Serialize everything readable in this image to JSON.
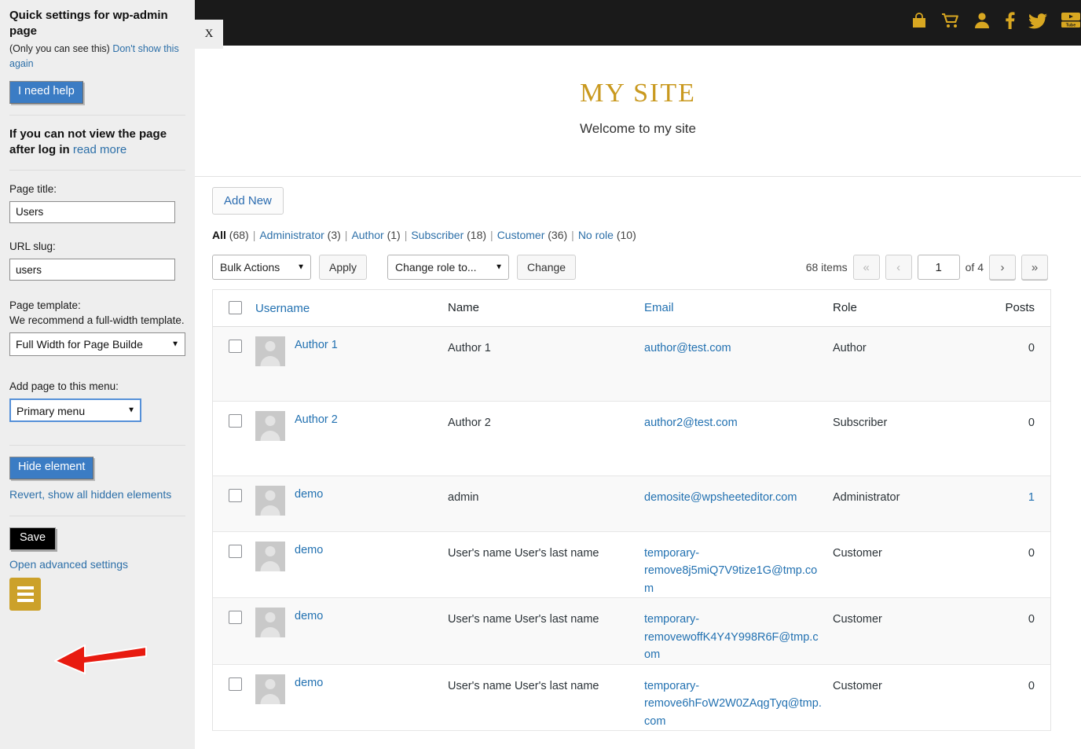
{
  "sidebar": {
    "heading": "Quick settings for wp-admin page",
    "note_text": "(Only you can see this)",
    "dont_show_link": "Don't show this again",
    "need_help_label": "I need help",
    "cant_view_text": "If you can not view the page after log in",
    "read_more_link": "read more",
    "page_title_label": "Page title:",
    "page_title_value": "Users",
    "url_slug_label": "URL slug:",
    "url_slug_value": "users",
    "page_template_label": "Page template:",
    "page_template_hint": "We recommend a full-width template.",
    "page_template_value": "Full Width for Page Builde",
    "menu_label": "Add page to this menu:",
    "menu_value": "Primary menu",
    "hide_element_label": "Hide element",
    "revert_link": "Revert, show all hidden elements",
    "save_label": "Save",
    "advanced_link": "Open advanced settings",
    "hamburger_icon": "hamburger-icon",
    "close_tab_label": "X"
  },
  "topbar": {
    "icons": [
      {
        "name": "shopping-bag-icon",
        "glyph": "bag"
      },
      {
        "name": "shopping-cart-icon",
        "glyph": "cart"
      },
      {
        "name": "user-account-icon",
        "glyph": "user"
      },
      {
        "name": "facebook-icon",
        "glyph": "f"
      },
      {
        "name": "twitter-icon",
        "glyph": "twitter"
      },
      {
        "name": "youtube-icon",
        "glyph": "youtube"
      }
    ],
    "icon_color": "#d8a721",
    "background": "#1a1a1a"
  },
  "site": {
    "title": "MY SITE",
    "tagline": "Welcome to my site",
    "title_color": "#c9991f"
  },
  "main": {
    "add_new_label": "Add New",
    "filters": [
      {
        "label": "All",
        "count": "(68)",
        "current": true
      },
      {
        "label": "Administrator",
        "count": "(3)",
        "current": false
      },
      {
        "label": "Author",
        "count": "(1)",
        "current": false
      },
      {
        "label": "Subscriber",
        "count": "(18)",
        "current": false
      },
      {
        "label": "Customer",
        "count": "(36)",
        "current": false
      },
      {
        "label": "No role",
        "count": "(10)",
        "current": false
      }
    ],
    "bulk_actions_value": "Bulk Actions",
    "apply_label": "Apply",
    "change_role_value": "Change role to...",
    "change_label": "Change",
    "items_count": "68 items",
    "page_first": "«",
    "page_prev": "‹",
    "page_current": "1",
    "page_of": "of 4",
    "page_next": "›",
    "page_last": "»",
    "columns": [
      "Username",
      "Name",
      "Email",
      "Role",
      "Posts"
    ],
    "rows": [
      {
        "username": "Author 1",
        "name": "Author 1",
        "email": "author@test.com",
        "role": "Author",
        "posts": "0"
      },
      {
        "username": "Author 2",
        "name": "Author 2",
        "email": "author2@test.com",
        "role": "Subscriber",
        "posts": "0"
      },
      {
        "username": "demo",
        "name": "admin",
        "email": "demosite@wpsheeteditor.com",
        "role": "Administrator",
        "posts": "1"
      },
      {
        "username": "demo",
        "name": "User's name User's last name",
        "email": "temporary-remove8j5miQ7V9tize1G@tmp.com",
        "role": "Customer",
        "posts": "0"
      },
      {
        "username": "demo",
        "name": "User's name User's last name",
        "email": "temporary-removewoffK4Y4Y998R6F@tmp.com",
        "role": "Customer",
        "posts": "0"
      },
      {
        "username": "demo",
        "name": "User's name User's last name",
        "email": "temporary-remove6hFoW2W0ZAqgTyq@tmp.com",
        "role": "Customer",
        "posts": "0"
      }
    ]
  }
}
